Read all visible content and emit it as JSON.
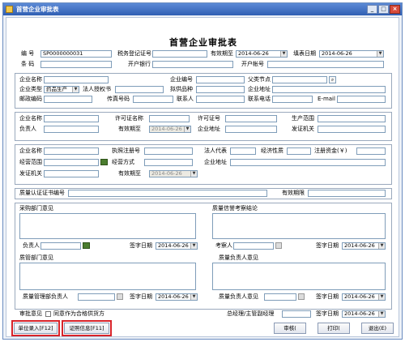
{
  "window": {
    "title": "首营企业审批表"
  },
  "form_title": "首营企业审批表",
  "header": {
    "code_label": "编  号",
    "code_value": "SP0000000031",
    "tax_label": "税务登记证号",
    "tax_value": "",
    "expire_label": "有效期至",
    "expire_value": "2014-06-26",
    "fill_date_label": "填表日期",
    "fill_date_value": "2014-06-26",
    "barcode_label": "条  码",
    "barcode_value": "",
    "bank_label": "开户银行",
    "bank_value": "",
    "account_label": "开户帐号",
    "account_value": ""
  },
  "company": {
    "name_label": "企业名称",
    "id_label": "企业编号",
    "parent_label": "父类节点",
    "type_label": "企业类型",
    "type_value": "药品生产",
    "rep_label": "法人授权书",
    "kinds_label": "拟供品种",
    "addr_label": "企业地址",
    "post_label": "邮政编码",
    "fax_label": "传真号码",
    "contact_label": "联系人",
    "phone_label": "联系电话",
    "email_label": "E-mail"
  },
  "license": {
    "name_label": "企业名称",
    "permit_label": "许可证名称",
    "permit_no_label": "许可证号",
    "scope_label": "生产范围",
    "head_label": "负责人",
    "expire_label": "有效期至",
    "expire_value": "2014-06-26",
    "addr_label": "企业地址",
    "issuer_label": "发证机关"
  },
  "business": {
    "name_label": "企业名称",
    "reg_label": "执照注册号",
    "legal_label": "法人代表",
    "nature_label": "经济性质",
    "capital_label": "注册资金(￥)",
    "range_label": "经营范围",
    "mode_label": "经营方式",
    "addr_label": "企业地址",
    "issuer_label": "发证机关",
    "expire_label": "有效期至",
    "expire_value": "2014-06-26"
  },
  "quality_cert": {
    "cert_label": "质量认证证书编号",
    "expire_label": "有效期限"
  },
  "opinions": {
    "purchase_label": "采购部门意见",
    "quality_label": "质量信誉考察结论",
    "head_label": "负责人",
    "sign_label": "签字日期",
    "sign_value": "2014-06-26",
    "inspector_label": "考察人",
    "sign_value2": "2014-06-26",
    "qdept_label": "质管部门意见",
    "qhead_label": "质量负责人意见",
    "qmanager_label": "质量管理部负责人",
    "sign_value3": "2014-06-26",
    "qhead_sign_label": "质量负责人意见",
    "sign_value4": "2014-06-26"
  },
  "footer": {
    "review_label": "审批意见",
    "agree_label": "同意作为合格供货方",
    "gm_label": "总经理/主管副经理",
    "sign_label": "签字日期",
    "sign_value": "2014-06-26"
  },
  "buttons": {
    "entry": "单位录入[F12]",
    "cert": "证照信息[F11]",
    "approve": "审核(",
    "print": "打印(",
    "exit": "退出(E)"
  }
}
